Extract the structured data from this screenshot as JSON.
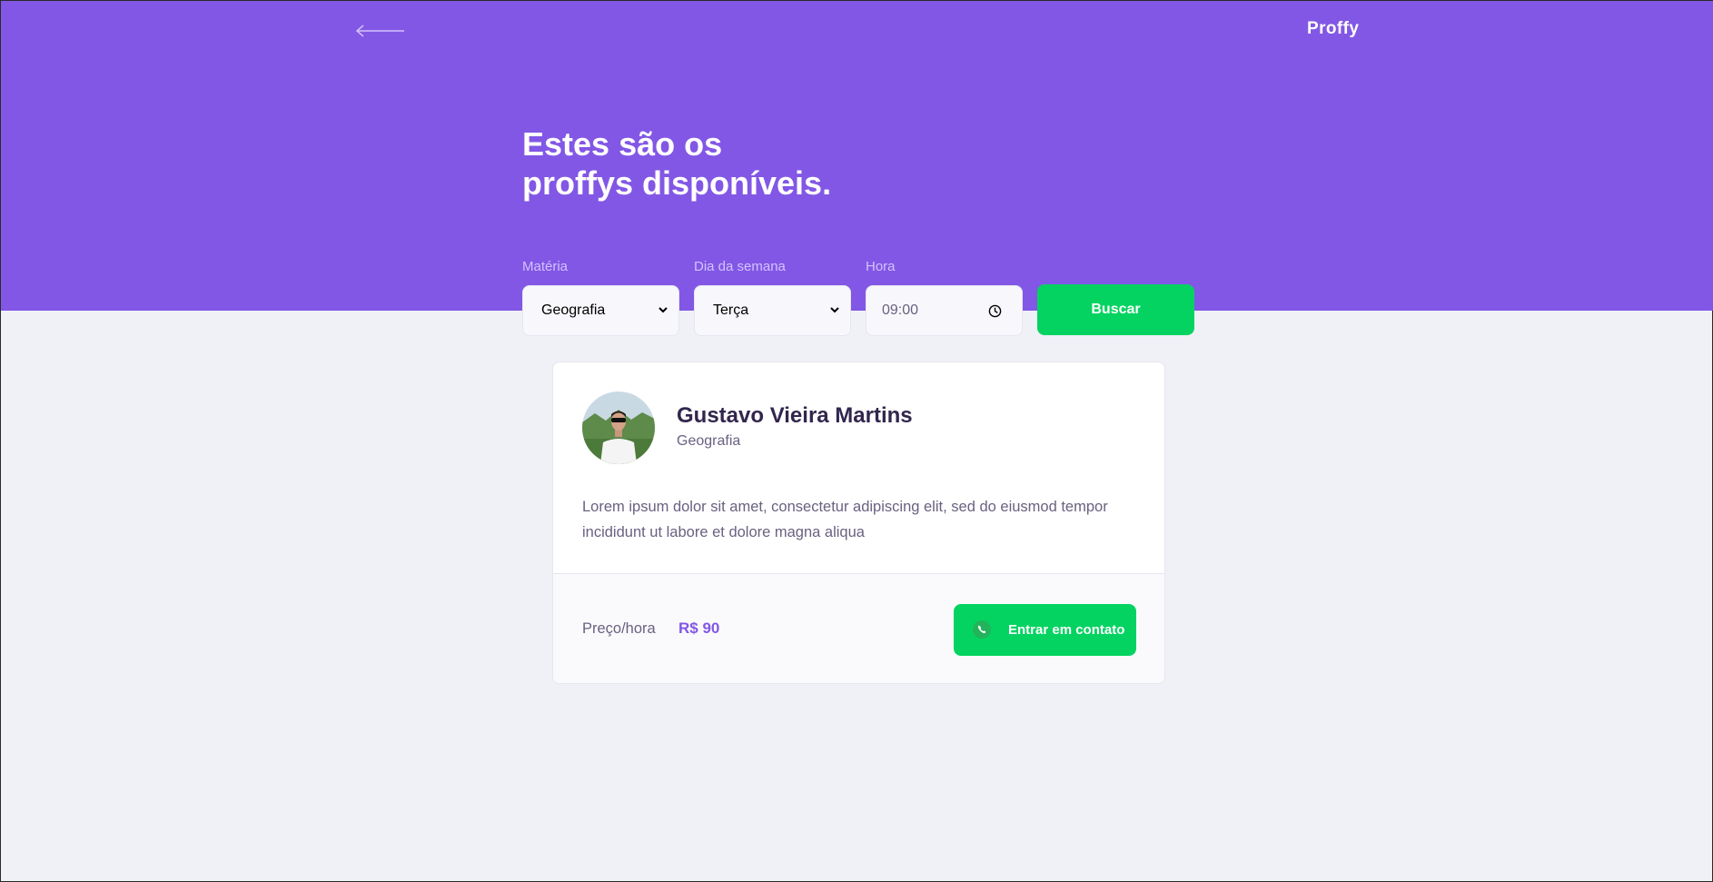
{
  "header": {
    "logo": "Proffy",
    "title_line1": "Estes são os",
    "title_line2": "proffys disponíveis."
  },
  "filters": {
    "subject": {
      "label": "Matéria",
      "value": "Geografia"
    },
    "weekday": {
      "label": "Dia da semana",
      "value": "Terça"
    },
    "time": {
      "label": "Hora",
      "value": "09:00"
    },
    "search_label": "Buscar"
  },
  "teacher": {
    "name": "Gustavo Vieira Martins",
    "subject": "Geografia",
    "bio": "Lorem ipsum dolor sit amet, consectetur adipiscing elit, sed do eiusmod tempor incididunt ut labore et dolore magna aliqua",
    "price_label": "Preço/hora",
    "price_value": "R$ 90",
    "contact_label": "Entrar em contato"
  },
  "icons": {
    "back": "arrow-left-icon",
    "chevron": "chevron-down-icon",
    "clock": "clock-icon",
    "whatsapp": "whatsapp-icon"
  },
  "colors": {
    "primary": "#8257E5",
    "secondary": "#04D361",
    "background": "#F0F0F7",
    "title_in_primary": "#FFFFFF",
    "text_title": "#32264D",
    "text_base": "#6A6180"
  }
}
